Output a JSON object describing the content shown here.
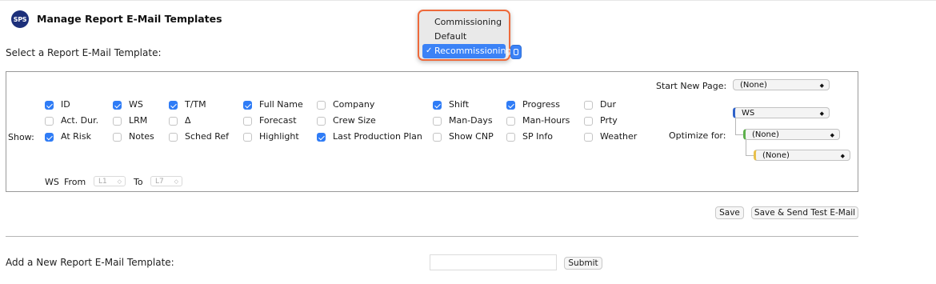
{
  "header": {
    "logo_text": "SPS",
    "title": "Manage Report E-Mail Templates",
    "select_label": "Select a Report E-Mail Template:"
  },
  "template_dropdown": {
    "options": [
      "Commissioning",
      "Default",
      "Recommissioning"
    ],
    "selected": "Recommissioning",
    "check_glyph": "✓",
    "accent_color": "#3b82f6",
    "highlight_border_color": "#ee6a3b"
  },
  "show": {
    "label": "Show:",
    "checkbox_color": "#2f7cf6",
    "columns": [
      [
        {
          "label": "ID",
          "checked": true
        },
        {
          "label": "Act. Dur.",
          "checked": false
        },
        {
          "label": "At Risk",
          "checked": true
        }
      ],
      [
        {
          "label": "WS",
          "checked": true
        },
        {
          "label": "LRM",
          "checked": false
        },
        {
          "label": "Notes",
          "checked": false
        }
      ],
      [
        {
          "label": "T/TM",
          "checked": true
        },
        {
          "label": "Δ",
          "checked": false
        },
        {
          "label": "Sched Ref",
          "checked": false
        }
      ],
      [
        {
          "label": "Full Name",
          "checked": true
        },
        {
          "label": "Forecast",
          "checked": false
        },
        {
          "label": "Highlight",
          "checked": false
        }
      ],
      [
        {
          "label": "Company",
          "checked": false
        },
        {
          "label": "Crew Size",
          "checked": false
        },
        {
          "label": "Last Production Plan",
          "checked": true
        }
      ],
      [
        {
          "label": "Shift",
          "checked": true
        },
        {
          "label": "Man-Days",
          "checked": false
        },
        {
          "label": "Show CNP",
          "checked": false
        }
      ],
      [
        {
          "label": "Progress",
          "checked": true
        },
        {
          "label": "Man-Hours",
          "checked": false
        },
        {
          "label": "SP Info",
          "checked": false
        }
      ],
      [
        {
          "label": "Dur",
          "checked": false
        },
        {
          "label": "Prty",
          "checked": false
        },
        {
          "label": "Weather",
          "checked": false
        }
      ]
    ]
  },
  "ws_range": {
    "label": "WS",
    "from_label": "From",
    "from_value": "L1",
    "to_label": "To",
    "to_value": "L7"
  },
  "start_new_page": {
    "label": "Start New Page:",
    "value": "(None)"
  },
  "optimize_for": {
    "label": "Optimize for:",
    "levels": [
      "WS",
      "(None)",
      "(None)"
    ],
    "level_colors": [
      "#2f62c9",
      "#5db04b",
      "#e8c04b"
    ]
  },
  "actions": {
    "save_label": "Save",
    "save_send_label": "Save & Send Test E-Mail"
  },
  "add_template": {
    "label": "Add a New Report E-Mail Template:",
    "input_value": "",
    "submit_label": "Submit"
  },
  "icons": {
    "select_arrow": "◆",
    "small_arrow": "◇"
  }
}
